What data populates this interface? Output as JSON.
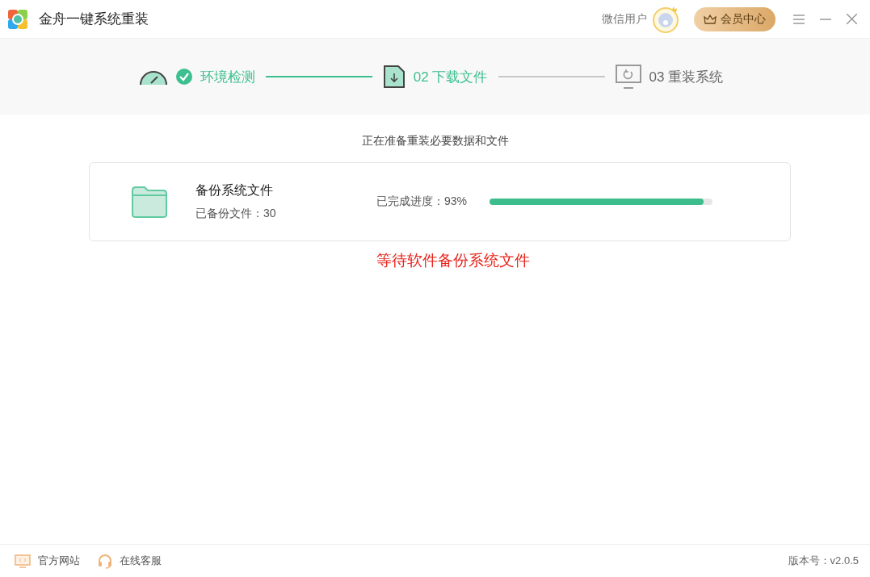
{
  "window": {
    "title": "金舟一键系统重装"
  },
  "user": {
    "name": "微信用户"
  },
  "vip_button": {
    "label": "会员中心"
  },
  "steps": [
    {
      "kind": "gauge",
      "label": "环境检测",
      "done": true,
      "reached": true
    },
    {
      "kind": "download",
      "label": "02 下载文件",
      "done": false,
      "reached": true
    },
    {
      "kind": "monitor",
      "label": "03 重装系统",
      "done": false,
      "reached": false
    }
  ],
  "subtitle": "正在准备重装必要数据和文件",
  "task": {
    "title": "备份系统文件",
    "count": "已备份文件：30",
    "progress_label": "已完成进度：93%",
    "level": 0.96
  },
  "note": "等待软件备份系统文件",
  "footer": {
    "links": [
      {
        "kind": "monitor",
        "label": "官方网站"
      },
      {
        "kind": "headset",
        "label": "在线客服"
      }
    ],
    "version": "版本号：v2.0.5"
  }
}
